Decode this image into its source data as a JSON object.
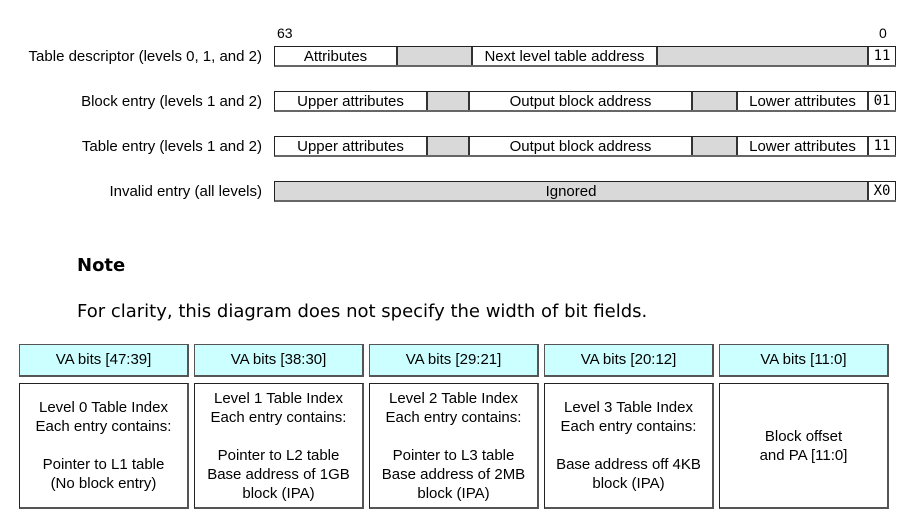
{
  "descriptor_diagram": {
    "bit_high_label": "63",
    "bit_low_label": "0",
    "rows": [
      {
        "label": "Table descriptor (levels 0, 1, and 2)",
        "fields": [
          {
            "text": "Attributes",
            "shade": "white"
          },
          {
            "text": "",
            "shade": "gray"
          },
          {
            "text": "Next level table address",
            "shade": "white"
          },
          {
            "text": "",
            "shade": "gray"
          },
          {
            "text": "11",
            "shade": "white",
            "code": true
          }
        ]
      },
      {
        "label": "Block entry (levels 1 and 2)",
        "fields": [
          {
            "text": "Upper attributes",
            "shade": "white"
          },
          {
            "text": "",
            "shade": "gray"
          },
          {
            "text": "Output block address",
            "shade": "white"
          },
          {
            "text": "",
            "shade": "gray"
          },
          {
            "text": "Lower attributes",
            "shade": "white"
          },
          {
            "text": "01",
            "shade": "white",
            "code": true
          }
        ]
      },
      {
        "label": "Table entry (levels 1 and 2)",
        "fields": [
          {
            "text": "Upper attributes",
            "shade": "white"
          },
          {
            "text": "",
            "shade": "gray"
          },
          {
            "text": "Output block address",
            "shade": "white"
          },
          {
            "text": "",
            "shade": "gray"
          },
          {
            "text": "Lower attributes",
            "shade": "white"
          },
          {
            "text": "11",
            "shade": "white",
            "code": true
          }
        ]
      },
      {
        "label": "Invalid entry (all levels)",
        "fields": [
          {
            "text": "Ignored",
            "shade": "gray"
          },
          {
            "text": "X0",
            "shade": "white",
            "code": true
          }
        ]
      }
    ]
  },
  "note": {
    "title": "Note",
    "text": "For clarity, this diagram does not specify the width of bit fields."
  },
  "va_table": {
    "header_color": "#ccffff",
    "columns": [
      {
        "header": "VA bits [47:39]",
        "lines_top": [
          "Level 0 Table Index",
          "Each entry contains:"
        ],
        "lines_bottom": [
          "Pointer to L1 table",
          "(No block entry)"
        ]
      },
      {
        "header": "VA bits [38:30]",
        "lines_top": [
          "Level 1 Table Index",
          "Each entry contains:"
        ],
        "lines_bottom": [
          "Pointer to L2 table",
          "Base address of 1GB",
          "block (IPA)"
        ]
      },
      {
        "header": "VA bits [29:21]",
        "lines_top": [
          "Level 2 Table Index",
          "Each entry contains:"
        ],
        "lines_bottom": [
          "Pointer to L3 table",
          "Base address of 2MB",
          "block (IPA)"
        ]
      },
      {
        "header": "VA bits [20:12]",
        "lines_top": [
          "Level 3 Table Index",
          "Each entry contains:"
        ],
        "lines_bottom": [
          "Base address off 4KB",
          "block (IPA)"
        ]
      },
      {
        "header": "VA bits [11:0]",
        "lines_top": [
          "Block offset",
          "and PA [11:0]"
        ],
        "lines_bottom": []
      }
    ]
  }
}
